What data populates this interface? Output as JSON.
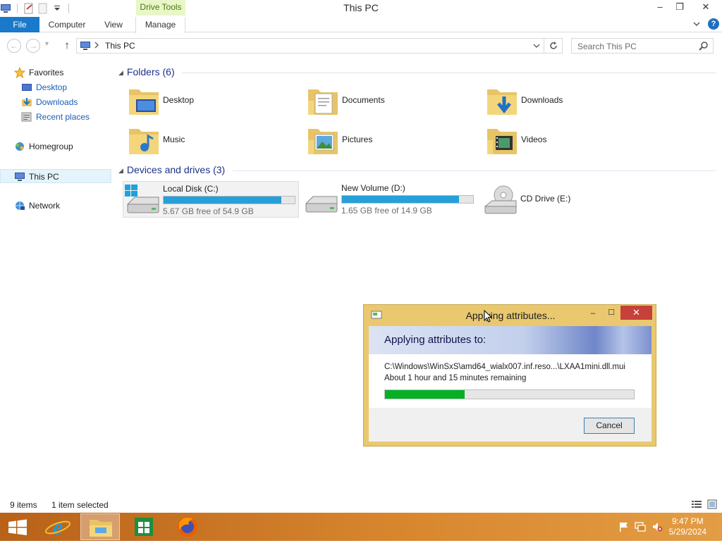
{
  "window": {
    "title": "This PC",
    "contextual_tab": "Drive Tools",
    "controls": {
      "minimize": "–",
      "maximize": "❐",
      "close": "✕"
    }
  },
  "ribbon": {
    "tabs": [
      {
        "label": "File"
      },
      {
        "label": "Computer"
      },
      {
        "label": "View"
      },
      {
        "label": "Manage"
      }
    ]
  },
  "address": {
    "back": "←",
    "forward": "→",
    "recent": "▾",
    "up": "↑",
    "path": "This PC",
    "search_placeholder": "Search This PC"
  },
  "nav": {
    "favorites": "Favorites",
    "desktop": "Desktop",
    "downloads": "Downloads",
    "recent": "Recent places",
    "homegroup": "Homegroup",
    "thispc": "This PC",
    "network": "Network"
  },
  "groups": {
    "folders_header": "Folders (6)",
    "drives_header": "Devices and drives (3)"
  },
  "folders": [
    {
      "name": "Desktop",
      "icon": "desktop-folder-icon"
    },
    {
      "name": "Documents",
      "icon": "documents-folder-icon"
    },
    {
      "name": "Downloads",
      "icon": "downloads-folder-icon"
    },
    {
      "name": "Music",
      "icon": "music-folder-icon"
    },
    {
      "name": "Pictures",
      "icon": "pictures-folder-icon"
    },
    {
      "name": "Videos",
      "icon": "videos-folder-icon"
    }
  ],
  "drives": [
    {
      "name": "Local Disk (C:)",
      "free": "5.67 GB free of 54.9 GB",
      "used_fraction": 0.9
    },
    {
      "name": "New Volume (D:)",
      "free": "1.65 GB free of 14.9 GB",
      "used_fraction": 0.89
    },
    {
      "name": "CD Drive (E:)"
    }
  ],
  "status": {
    "items": "9 items",
    "selected": "1 item selected"
  },
  "dialog": {
    "title": "Applying attributes...",
    "heading": "Applying attributes to:",
    "path": "C:\\Windows\\WinSxS\\amd64_wialx007.inf.reso...\\LXAA1mini.dll.mui",
    "time_remaining": "About 1 hour and 15 minutes remaining",
    "progress_fraction": 0.32,
    "cancel": "Cancel"
  },
  "taskbar": {
    "time": "9:47 PM",
    "date": "5/29/2024"
  },
  "colors": {
    "file_tab": "#1979ca",
    "progress_green": "#06b025",
    "drive_bar": "#26a0da",
    "taskbar": "#d8862e",
    "dialog_frame": "#e9c86f",
    "close_red": "#c7413a"
  }
}
